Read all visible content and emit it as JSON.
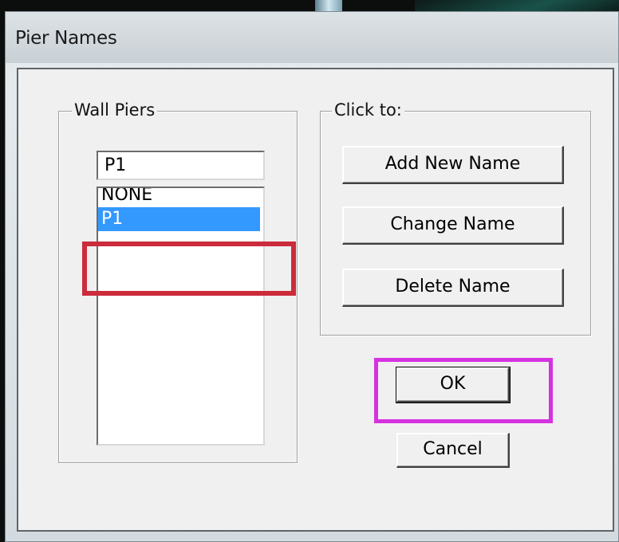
{
  "window": {
    "title": "Pier Names"
  },
  "wall_piers": {
    "legend": "Wall Piers",
    "name_input_value": "P1",
    "list_items": [
      "NONE",
      "P1"
    ],
    "selected_index": 1
  },
  "click_to": {
    "legend": "Click to:",
    "add_label": "Add New Name",
    "change_label": "Change Name",
    "delete_label": "Delete Name"
  },
  "actions": {
    "ok_label": "OK",
    "cancel_label": "Cancel"
  },
  "annotations": {
    "red_box_color": "#cc2b3b",
    "magenta_box_color": "#d632e0"
  }
}
